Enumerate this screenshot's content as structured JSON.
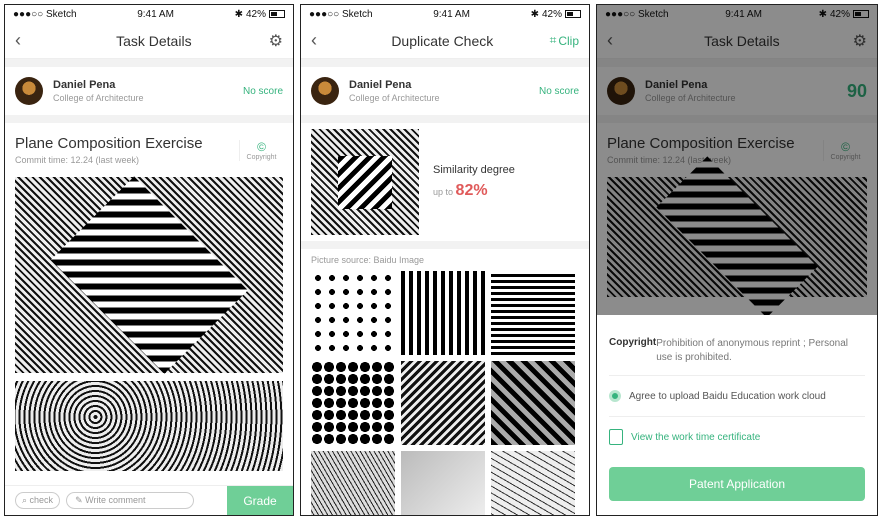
{
  "screens": {
    "task_details": {
      "status": {
        "carrier": "●●●○○ Sketch",
        "time": "9:41 AM",
        "battery": "42%"
      },
      "title": "Task Details",
      "user": {
        "name": "Daniel Pena",
        "college": "College of Architecture",
        "score": "No score"
      },
      "work": {
        "title": "Plane Composition Exercise",
        "commit": "Commit time: 12.24 (last week)",
        "copyright_label": "Copyright"
      },
      "bottom": {
        "check": "check",
        "comment_placeholder": "Write comment",
        "grade": "Grade"
      }
    },
    "duplicate_check": {
      "status": {
        "carrier": "●●●○○ Sketch",
        "time": "9:41 AM",
        "battery": "42%"
      },
      "title": "Duplicate Check",
      "clip": "Clip",
      "user": {
        "name": "Daniel Pena",
        "college": "College of Architecture",
        "score": "No score"
      },
      "similarity": {
        "label": "Similarity degree",
        "prefix": "up to",
        "value": "82%"
      },
      "source": "Picture source: Baidu Image"
    },
    "patent": {
      "status": {
        "carrier": "●●●○○ Sketch",
        "time": "9:41 AM",
        "battery": "42%"
      },
      "title": "Task Details",
      "user": {
        "name": "Daniel Pena",
        "college": "College of Architecture",
        "score": "90"
      },
      "work": {
        "title": "Plane Composition Exercise",
        "commit": "Commit time: 12.24 (last week)",
        "copyright_label": "Copyright"
      },
      "sheet": {
        "copyright_key": "Copyright",
        "copyright_value": "Prohibition of anonymous reprint ; Personal use is prohibited.",
        "agree": "Agree to upload Baidu Education work cloud",
        "certificate": "View the work time certificate",
        "button": "Patent Application"
      }
    }
  },
  "colors": {
    "accent": "#36b37e",
    "button": "#6fcf97",
    "highlight": "#e05a5a"
  }
}
